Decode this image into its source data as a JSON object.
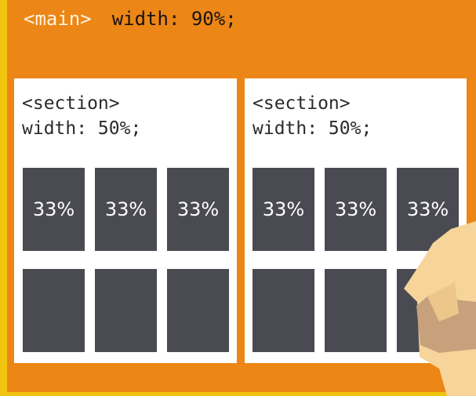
{
  "main": {
    "tag": "<main>",
    "declaration": "width: 90%;"
  },
  "sections": [
    {
      "tag": "<section>",
      "declaration": "width: 50%;",
      "boxes": [
        "33%",
        "33%",
        "33%",
        "",
        "",
        ""
      ]
    },
    {
      "tag": "<section>",
      "declaration": "width: 50%;",
      "boxes": [
        "33%",
        "33%",
        "33%",
        "",
        "",
        ""
      ]
    }
  ],
  "colors": {
    "background": "#ec8616",
    "box": "#4a4b52",
    "accent_strip": "#f1c40f"
  }
}
